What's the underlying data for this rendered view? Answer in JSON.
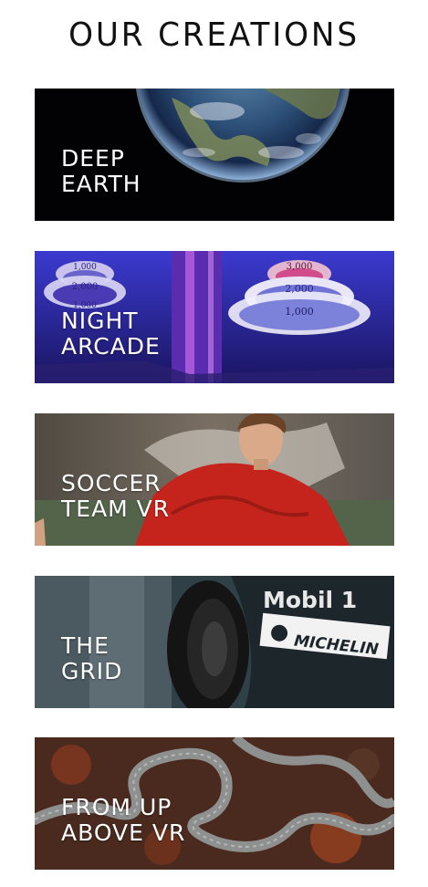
{
  "heading": "OUR CREATIONS",
  "cards": [
    {
      "label": "DEEP\nEARTH",
      "image": "earth-from-space"
    },
    {
      "label": "NIGHT\nARCADE",
      "image": "skee-ball-arcade"
    },
    {
      "label": "SOCCER\nTEAM VR",
      "image": "soccer-player"
    },
    {
      "label": "THE\nGRID",
      "image": "race-car-tire",
      "sponsor_text": [
        "Mobil 1",
        "MICHELIN"
      ]
    },
    {
      "label": "FROM UP\nABOVE VR",
      "image": "winding-road-aerial"
    }
  ],
  "arcade_numbers": [
    "1,000",
    "2,000",
    "1,000",
    "3,000",
    "2,000",
    "1,000"
  ],
  "colors": {
    "accent": "#ffffff",
    "text": "#111111"
  }
}
